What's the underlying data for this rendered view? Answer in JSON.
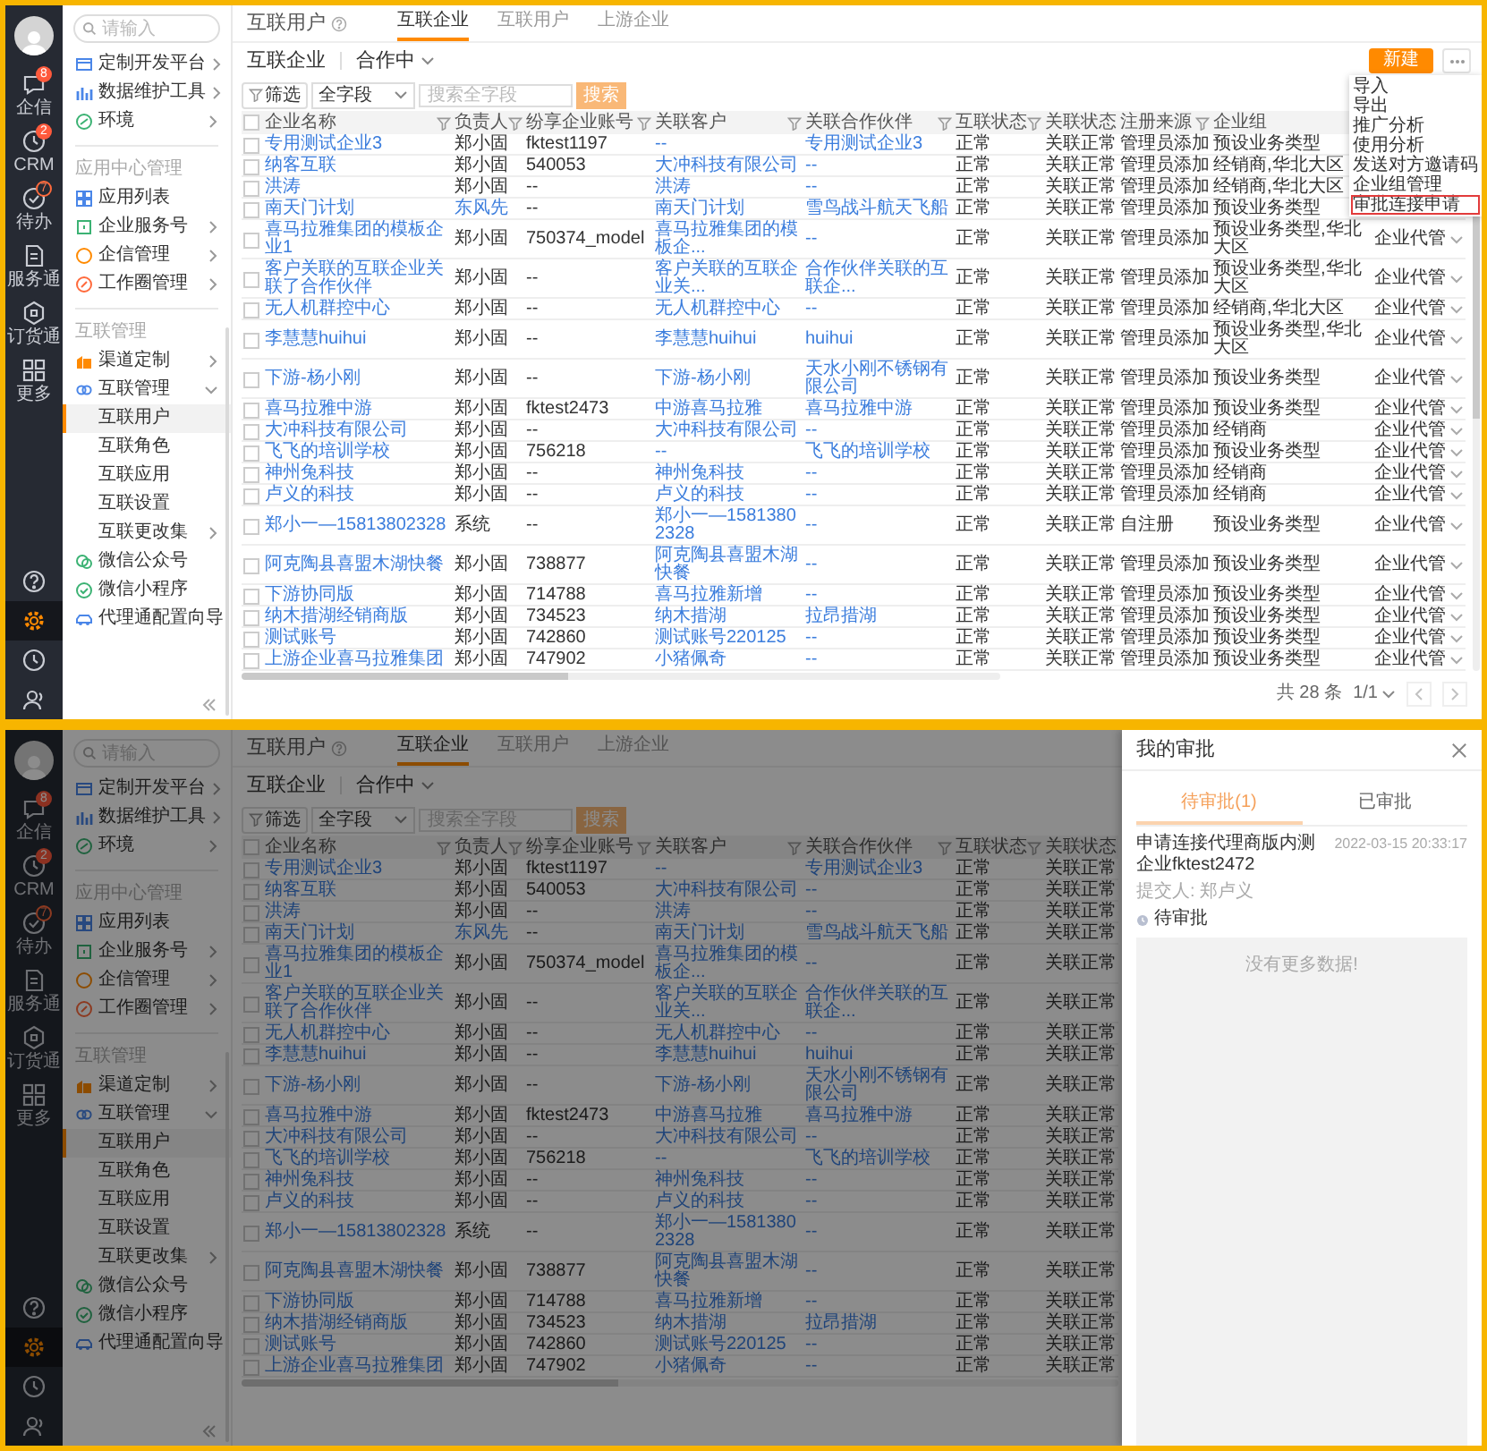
{
  "screens": [
    {
      "rail": {
        "items": [
          {
            "label": "企信",
            "badge": "8",
            "outlined": false,
            "selected": false
          },
          {
            "label": "CRM",
            "badge": "2",
            "outlined": false,
            "selected": false
          },
          {
            "label": "待办",
            "badge": "7",
            "outlined": true,
            "selected": false
          },
          {
            "label": "服务通",
            "selected": false
          },
          {
            "label": "订货通",
            "selected": false
          },
          {
            "label": "更多",
            "selected": false
          }
        ],
        "tools": [
          {
            "selected": false
          },
          {
            "selected": true
          },
          {
            "selected": false
          },
          {
            "selected": false
          }
        ]
      },
      "sidebar": {
        "search": {
          "placeholder": "请输入"
        },
        "groups": [
          {
            "items": [
              {
                "label": "定制开发平台",
                "chevron": true,
                "selected": false
              },
              {
                "label": "数据维护工具",
                "chevron": true,
                "selected": false
              },
              {
                "label": "环境",
                "chevron": true,
                "selected": false
              }
            ]
          },
          {
            "heading": "应用中心管理",
            "items": [
              {
                "label": "应用列表",
                "chevron": false,
                "selected": false
              },
              {
                "label": "企业服务号",
                "chevron": true,
                "selected": false
              },
              {
                "label": "企信管理",
                "chevron": true,
                "selected": false
              },
              {
                "label": "工作圈管理",
                "chevron": true,
                "selected": false
              }
            ]
          },
          {
            "heading": "互联管理",
            "items": [
              {
                "label": "渠道定制",
                "chevron": true,
                "selected": false
              },
              {
                "label": "互联管理",
                "expanded": true,
                "selected": false,
                "children": [
                  {
                    "label": "互联用户",
                    "chevron": false,
                    "selected": true
                  },
                  {
                    "label": "互联角色",
                    "chevron": false,
                    "selected": false
                  },
                  {
                    "label": "互联应用",
                    "chevron": false,
                    "selected": false
                  },
                  {
                    "label": "互联设置",
                    "chevron": false,
                    "selected": false
                  },
                  {
                    "label": "互联更改集",
                    "chevron": true,
                    "selected": false
                  }
                ]
              },
              {
                "label": "微信公众号",
                "chevron": false,
                "selected": false
              },
              {
                "label": "微信小程序",
                "chevron": false,
                "selected": false
              },
              {
                "label": "代理通配置向导",
                "chevron": false,
                "selected": false
              }
            ]
          }
        ]
      },
      "main": {
        "title": "互联用户",
        "tabs": [
          {
            "label": "互联企业",
            "selected": true
          },
          {
            "label": "互联用户",
            "selected": false
          },
          {
            "label": "上游企业",
            "selected": false
          }
        ],
        "heading": "互联企业",
        "view": "合作中",
        "new_button": "新建",
        "menu": {
          "items": [
            {
              "label": "导入",
              "highlighted": false
            },
            {
              "label": "导出",
              "highlighted": false
            },
            {
              "label": "推广分析",
              "highlighted": false
            },
            {
              "label": "使用分析",
              "highlighted": false
            },
            {
              "label": "发送对方邀请码",
              "highlighted": false
            },
            {
              "label": "企业组管理",
              "highlighted": false
            },
            {
              "label": "审批连接申请",
              "highlighted": true
            }
          ]
        },
        "filter": {
          "button": "筛选",
          "field": "全字段",
          "placeholder": "搜索全字段",
          "search_button": "搜索"
        },
        "table": {
          "all_checked": false,
          "columns": [
            {
              "label": "企业名称",
              "filter": true,
              "kind": "link"
            },
            {
              "label": "负责人",
              "filter": true,
              "kind": "person"
            },
            {
              "label": "纷享企业账号",
              "filter": true,
              "kind": "text"
            },
            {
              "label": "关联客户",
              "filter": true,
              "kind": "link"
            },
            {
              "label": "关联合作伙伴",
              "filter": true,
              "kind": "link"
            },
            {
              "label": "互联状态",
              "filter": true,
              "kind": "text"
            },
            {
              "label": "关联状态",
              "filter": false,
              "kind": "text"
            },
            {
              "label": "注册来源",
              "filter": true,
              "kind": "text"
            },
            {
              "label": "企业组",
              "filter": false,
              "kind": "text"
            }
          ],
          "rows": [
            {
              "checked": false,
              "owner_link": false,
              "cells": [
                "专用测试企业3",
                "郑小固",
                "fktest1197",
                "--",
                "专用测试企业3",
                "正常",
                "关联正常",
                "管理员添加",
                "预设业务类型"
              ]
            },
            {
              "checked": false,
              "owner_link": false,
              "cells": [
                "纳客互联",
                "郑小固",
                "540053",
                "大冲科技有限公司",
                "--",
                "正常",
                "关联正常",
                "管理员添加",
                "经销商,华北大区"
              ]
            },
            {
              "checked": false,
              "owner_link": false,
              "cells": [
                "洪涛",
                "郑小固",
                "--",
                "洪涛",
                "--",
                "正常",
                "关联正常",
                "管理员添加",
                "经销商,华北大区"
              ]
            },
            {
              "checked": false,
              "owner_link": true,
              "cells": [
                "南天门计划",
                "东风先",
                "--",
                "南天门计划",
                "雪鸟战斗航天飞船",
                "正常",
                "关联正常",
                "管理员添加",
                "预设业务类型"
              ]
            },
            {
              "checked": false,
              "owner_link": false,
              "cells": [
                "喜马拉雅集团的模板企业1",
                "郑小固",
                "750374_model",
                "喜马拉雅集团的模板企...",
                "--",
                "正常",
                "关联正常",
                "管理员添加",
                "预设业务类型,华北大区"
              ],
              "hosting": "企业代管"
            },
            {
              "checked": false,
              "owner_link": false,
              "cells": [
                "客户关联的互联企业关联了合作伙伴",
                "郑小固",
                "--",
                "客户关联的互联企业关...",
                "合作伙伴关联的互联企...",
                "正常",
                "关联正常",
                "管理员添加",
                "预设业务类型,华北大区"
              ],
              "hosting": "企业代管"
            },
            {
              "checked": false,
              "owner_link": false,
              "cells": [
                "无人机群控中心",
                "郑小固",
                "--",
                "无人机群控中心",
                "--",
                "正常",
                "关联正常",
                "管理员添加",
                "经销商,华北大区"
              ],
              "hosting": "企业代管"
            },
            {
              "checked": false,
              "owner_link": false,
              "cells": [
                "李慧慧huihui",
                "郑小固",
                "--",
                "李慧慧huihui",
                "huihui",
                "正常",
                "关联正常",
                "管理员添加",
                "预设业务类型,华北大区"
              ],
              "hosting": "企业代管"
            },
            {
              "checked": false,
              "owner_link": false,
              "cells": [
                "下游-杨小刚",
                "郑小固",
                "--",
                "下游-杨小刚",
                "天水小刚不锈钢有限公司",
                "正常",
                "关联正常",
                "管理员添加",
                "预设业务类型"
              ],
              "hosting": "企业代管"
            },
            {
              "checked": false,
              "owner_link": false,
              "cells": [
                "喜马拉雅中游",
                "郑小固",
                "fktest2473",
                "中游喜马拉雅",
                "喜马拉雅中游",
                "正常",
                "关联正常",
                "管理员添加",
                "预设业务类型"
              ],
              "hosting": "企业代管"
            },
            {
              "checked": false,
              "owner_link": false,
              "cells": [
                "大冲科技有限公司",
                "郑小固",
                "--",
                "大冲科技有限公司",
                "--",
                "正常",
                "关联正常",
                "管理员添加",
                "经销商"
              ],
              "hosting": "企业代管"
            },
            {
              "checked": false,
              "owner_link": false,
              "cells": [
                "飞飞的培训学校",
                "郑小固",
                "756218",
                "--",
                "飞飞的培训学校",
                "正常",
                "关联正常",
                "管理员添加",
                "预设业务类型"
              ],
              "hosting": "企业代管"
            },
            {
              "checked": false,
              "owner_link": false,
              "cells": [
                "神州兔科技",
                "郑小固",
                "--",
                "神州兔科技",
                "--",
                "正常",
                "关联正常",
                "管理员添加",
                "经销商"
              ],
              "hosting": "企业代管"
            },
            {
              "checked": false,
              "owner_link": false,
              "cells": [
                "卢义的科技",
                "郑小固",
                "--",
                "卢义的科技",
                "--",
                "正常",
                "关联正常",
                "管理员添加",
                "经销商"
              ],
              "hosting": "企业代管"
            },
            {
              "checked": false,
              "owner_link": false,
              "cells": [
                "郑小一—15813802328",
                "系统",
                "--",
                "郑小一—15813802328",
                "--",
                "正常",
                "关联正常",
                "自注册",
                "预设业务类型"
              ],
              "hosting": "企业代管"
            },
            {
              "checked": false,
              "owner_link": false,
              "cells": [
                "阿克陶县喜盟木湖快餐",
                "郑小固",
                "738877",
                "阿克陶县喜盟木湖快餐",
                "--",
                "正常",
                "关联正常",
                "管理员添加",
                "预设业务类型"
              ],
              "hosting": "企业代管"
            },
            {
              "checked": false,
              "owner_link": false,
              "cells": [
                "下游协同版",
                "郑小固",
                "714788",
                "喜马拉雅新增",
                "--",
                "正常",
                "关联正常",
                "管理员添加",
                "预设业务类型"
              ],
              "hosting": "企业代管"
            },
            {
              "checked": false,
              "owner_link": false,
              "cells": [
                "纳木措湖经销商版",
                "郑小固",
                "734523",
                "纳木措湖",
                "拉昂措湖",
                "正常",
                "关联正常",
                "管理员添加",
                "预设业务类型"
              ],
              "hosting": "企业代管"
            },
            {
              "checked": false,
              "owner_link": false,
              "cells": [
                "测试账号",
                "郑小固",
                "742860",
                "测试账号220125",
                "--",
                "正常",
                "关联正常",
                "管理员添加",
                "预设业务类型"
              ],
              "hosting": "企业代管"
            },
            {
              "checked": false,
              "owner_link": false,
              "cells": [
                "上游企业喜马拉雅集团",
                "郑小固",
                "747902",
                "小猪佩奇",
                "--",
                "正常",
                "关联正常",
                "管理员添加",
                "预设业务类型"
              ],
              "hosting": "企业代管"
            }
          ]
        },
        "pagination": {
          "total": "共 28 条",
          "page": "1/1"
        }
      }
    },
    {
      "rail": {
        "items": [
          {
            "label": "企信",
            "badge": "8",
            "outlined": false,
            "selected": false
          },
          {
            "label": "CRM",
            "badge": "2",
            "outlined": false,
            "selected": false
          },
          {
            "label": "待办",
            "badge": "7",
            "outlined": true,
            "selected": false
          },
          {
            "label": "服务通",
            "selected": false
          },
          {
            "label": "订货通",
            "selected": false
          },
          {
            "label": "更多",
            "selected": false
          }
        ],
        "tools": [
          {
            "selected": false
          },
          {
            "selected": true
          },
          {
            "selected": false
          },
          {
            "selected": false
          }
        ]
      },
      "sidebar": {
        "search": {
          "placeholder": "请输入"
        },
        "groups": [
          {
            "items": [
              {
                "label": "定制开发平台",
                "chevron": true,
                "selected": false
              },
              {
                "label": "数据维护工具",
                "chevron": true,
                "selected": false
              },
              {
                "label": "环境",
                "chevron": true,
                "selected": false
              }
            ]
          },
          {
            "heading": "应用中心管理",
            "items": [
              {
                "label": "应用列表",
                "chevron": false,
                "selected": false
              },
              {
                "label": "企业服务号",
                "chevron": true,
                "selected": false
              },
              {
                "label": "企信管理",
                "chevron": true,
                "selected": false
              },
              {
                "label": "工作圈管理",
                "chevron": true,
                "selected": false
              }
            ]
          },
          {
            "heading": "互联管理",
            "items": [
              {
                "label": "渠道定制",
                "chevron": true,
                "selected": false
              },
              {
                "label": "互联管理",
                "expanded": true,
                "selected": false,
                "children": [
                  {
                    "label": "互联用户",
                    "chevron": false,
                    "selected": true
                  },
                  {
                    "label": "互联角色",
                    "chevron": false,
                    "selected": false
                  },
                  {
                    "label": "互联应用",
                    "chevron": false,
                    "selected": false
                  },
                  {
                    "label": "互联设置",
                    "chevron": false,
                    "selected": false
                  },
                  {
                    "label": "互联更改集",
                    "chevron": true,
                    "selected": false
                  }
                ]
              },
              {
                "label": "微信公众号",
                "chevron": false,
                "selected": false
              },
              {
                "label": "微信小程序",
                "chevron": false,
                "selected": false
              },
              {
                "label": "代理通配置向导",
                "chevron": false,
                "selected": false
              }
            ]
          }
        ]
      },
      "main": {
        "title": "互联用户",
        "tabs": [
          {
            "label": "互联企业",
            "selected": true
          },
          {
            "label": "互联用户",
            "selected": false
          },
          {
            "label": "上游企业",
            "selected": false
          }
        ],
        "heading": "互联企业",
        "view": "合作中",
        "filter": {
          "button": "筛选",
          "field": "全字段",
          "placeholder": "搜索全字段",
          "search_button": "搜索"
        },
        "table": {
          "all_checked": false,
          "columns": [
            {
              "label": "企业名称",
              "filter": true,
              "kind": "link"
            },
            {
              "label": "负责人",
              "filter": true,
              "kind": "person"
            },
            {
              "label": "纷享企业账号",
              "filter": true,
              "kind": "text"
            },
            {
              "label": "关联客户",
              "filter": true,
              "kind": "link"
            },
            {
              "label": "关联合作伙伴",
              "filter": true,
              "kind": "link"
            },
            {
              "label": "互联状态",
              "filter": true,
              "kind": "text"
            },
            {
              "label": "关联状态",
              "filter": false,
              "kind": "text"
            }
          ],
          "rows": [
            {
              "checked": false,
              "owner_link": false,
              "cells": [
                "专用测试企业3",
                "郑小固",
                "fktest1197",
                "--",
                "专用测试企业3",
                "正常",
                "关联正常"
              ]
            },
            {
              "checked": false,
              "owner_link": false,
              "cells": [
                "纳客互联",
                "郑小固",
                "540053",
                "大冲科技有限公司",
                "--",
                "正常",
                "关联正常"
              ]
            },
            {
              "checked": false,
              "owner_link": false,
              "cells": [
                "洪涛",
                "郑小固",
                "--",
                "洪涛",
                "--",
                "正常",
                "关联正常"
              ]
            },
            {
              "checked": false,
              "owner_link": true,
              "cells": [
                "南天门计划",
                "东风先",
                "--",
                "南天门计划",
                "雪鸟战斗航天飞船",
                "正常",
                "关联正常"
              ]
            },
            {
              "checked": false,
              "owner_link": false,
              "cells": [
                "喜马拉雅集团的模板企业1",
                "郑小固",
                "750374_model",
                "喜马拉雅集团的模板企...",
                "--",
                "正常",
                "关联正常"
              ]
            },
            {
              "checked": false,
              "owner_link": false,
              "cells": [
                "客户关联的互联企业关联了合作伙伴",
                "郑小固",
                "--",
                "客户关联的互联企业关...",
                "合作伙伴关联的互联企...",
                "正常",
                "关联正常"
              ]
            },
            {
              "checked": false,
              "owner_link": false,
              "cells": [
                "无人机群控中心",
                "郑小固",
                "--",
                "无人机群控中心",
                "--",
                "正常",
                "关联正常"
              ]
            },
            {
              "checked": false,
              "owner_link": false,
              "cells": [
                "李慧慧huihui",
                "郑小固",
                "--",
                "李慧慧huihui",
                "huihui",
                "正常",
                "关联正常"
              ]
            },
            {
              "checked": false,
              "owner_link": false,
              "cells": [
                "下游-杨小刚",
                "郑小固",
                "--",
                "下游-杨小刚",
                "天水小刚不锈钢有限公司",
                "正常",
                "关联正常"
              ]
            },
            {
              "checked": false,
              "owner_link": false,
              "cells": [
                "喜马拉雅中游",
                "郑小固",
                "fktest2473",
                "中游喜马拉雅",
                "喜马拉雅中游",
                "正常",
                "关联正常"
              ]
            },
            {
              "checked": false,
              "owner_link": false,
              "cells": [
                "大冲科技有限公司",
                "郑小固",
                "--",
                "大冲科技有限公司",
                "--",
                "正常",
                "关联正常"
              ]
            },
            {
              "checked": false,
              "owner_link": false,
              "cells": [
                "飞飞的培训学校",
                "郑小固",
                "756218",
                "--",
                "飞飞的培训学校",
                "正常",
                "关联正常"
              ]
            },
            {
              "checked": false,
              "owner_link": false,
              "cells": [
                "神州兔科技",
                "郑小固",
                "--",
                "神州兔科技",
                "--",
                "正常",
                "关联正常"
              ]
            },
            {
              "checked": false,
              "owner_link": false,
              "cells": [
                "卢义的科技",
                "郑小固",
                "--",
                "卢义的科技",
                "--",
                "正常",
                "关联正常"
              ]
            },
            {
              "checked": false,
              "owner_link": false,
              "cells": [
                "郑小一—15813802328",
                "系统",
                "--",
                "郑小一—15813802328",
                "--",
                "正常",
                "关联正常"
              ]
            },
            {
              "checked": false,
              "owner_link": false,
              "cells": [
                "阿克陶县喜盟木湖快餐",
                "郑小固",
                "738877",
                "阿克陶县喜盟木湖快餐",
                "--",
                "正常",
                "关联正常"
              ]
            },
            {
              "checked": false,
              "owner_link": false,
              "cells": [
                "下游协同版",
                "郑小固",
                "714788",
                "喜马拉雅新增",
                "--",
                "正常",
                "关联正常"
              ]
            },
            {
              "checked": false,
              "owner_link": false,
              "cells": [
                "纳木措湖经销商版",
                "郑小固",
                "734523",
                "纳木措湖",
                "拉昂措湖",
                "正常",
                "关联正常"
              ]
            },
            {
              "checked": false,
              "owner_link": false,
              "cells": [
                "测试账号",
                "郑小固",
                "742860",
                "测试账号220125",
                "--",
                "正常",
                "关联正常"
              ]
            },
            {
              "checked": false,
              "owner_link": false,
              "cells": [
                "上游企业喜马拉雅集团",
                "郑小固",
                "747902",
                "小猪佩奇",
                "--",
                "正常",
                "关联正常"
              ]
            }
          ]
        }
      },
      "drawer": {
        "title": "我的审批",
        "tabs": [
          {
            "label": "待审批(1)",
            "selected": true
          },
          {
            "label": "已审批",
            "selected": false
          }
        ],
        "items": [
          {
            "title": "申请连接代理商版内测企业fktest2472",
            "time": "2022-03-15 20:33:17",
            "submitter": "提交人: 郑卢义",
            "status": "待审批"
          }
        ],
        "empty_text": "没有更多数据!"
      }
    }
  ]
}
